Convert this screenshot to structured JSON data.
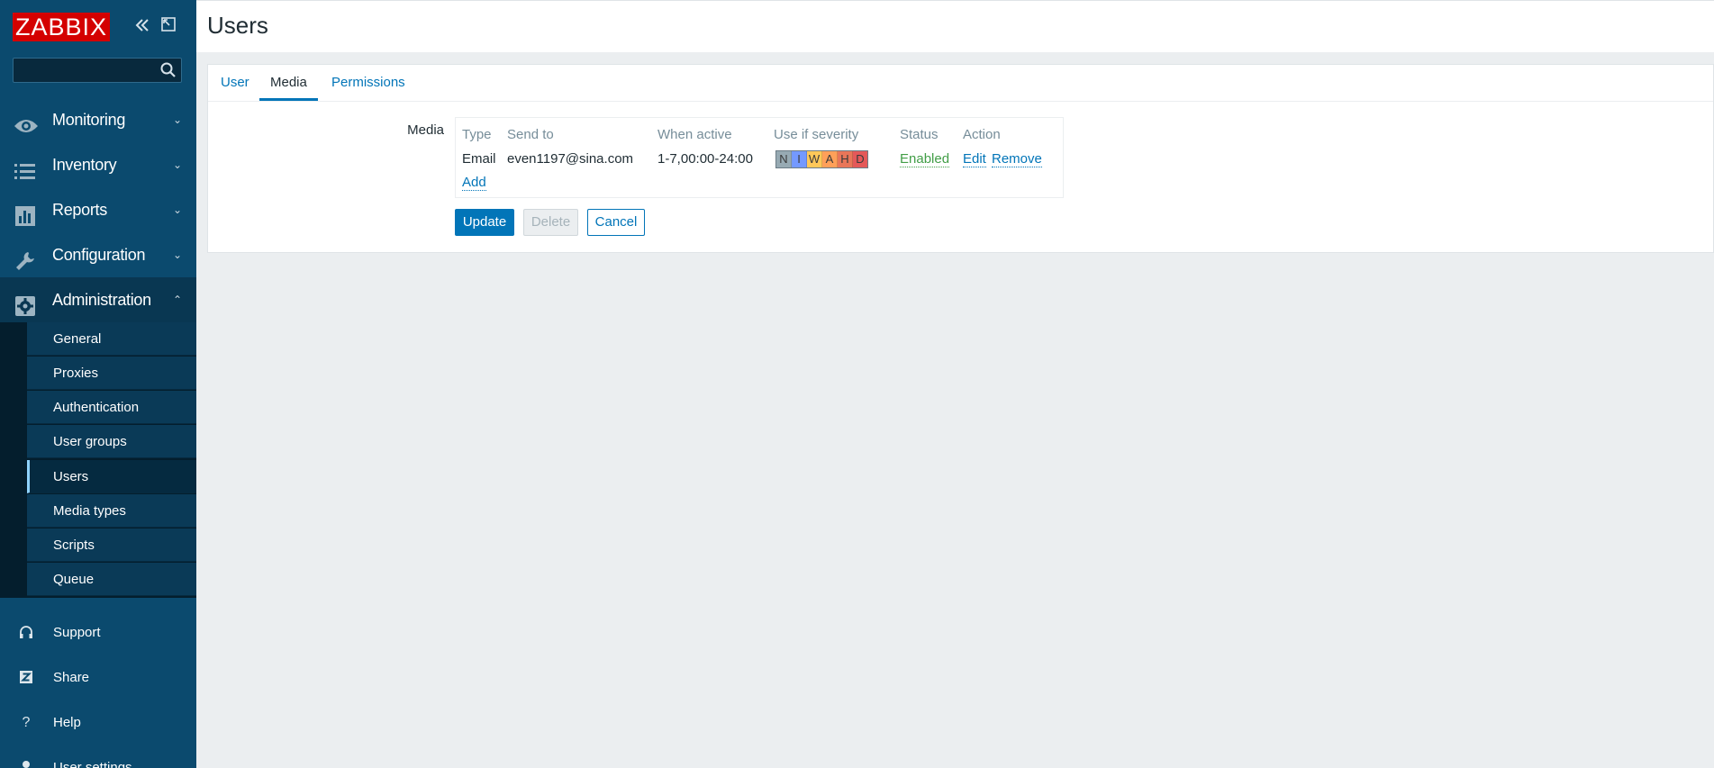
{
  "sidebar": {
    "logo": "ZABBIX",
    "search": {
      "placeholder": ""
    },
    "menu": [
      {
        "label": "Monitoring",
        "icon": "eye-icon"
      },
      {
        "label": "Inventory",
        "icon": "list-icon"
      },
      {
        "label": "Reports",
        "icon": "bar-chart-icon"
      },
      {
        "label": "Configuration",
        "icon": "wrench-icon"
      },
      {
        "label": "Administration",
        "icon": "gear-icon"
      }
    ],
    "submenu": [
      "General",
      "Proxies",
      "Authentication",
      "User groups",
      "Users",
      "Media types",
      "Scripts",
      "Queue"
    ],
    "current_submenu": "Users",
    "bottom": [
      {
        "label": "Support",
        "icon": "headset-icon"
      },
      {
        "label": "Share",
        "icon": "share-z-icon"
      },
      {
        "label": "Help",
        "icon": "question-icon"
      },
      {
        "label": "User settings",
        "icon": "user-icon"
      }
    ]
  },
  "header": {
    "title": "Users"
  },
  "tabs": [
    {
      "label": "User"
    },
    {
      "label": "Media"
    },
    {
      "label": "Permissions"
    }
  ],
  "active_tab": "Media",
  "form": {
    "media_label": "Media",
    "columns": [
      "Type",
      "Send to",
      "When active",
      "Use if severity",
      "Status",
      "Action"
    ],
    "rows": [
      {
        "type": "Email",
        "send_to": "even1197@sina.com",
        "when_active": "1-7,00:00-24:00",
        "severities": [
          {
            "letter": "N",
            "color": "#97aab3"
          },
          {
            "letter": "I",
            "color": "#7499ff"
          },
          {
            "letter": "W",
            "color": "#ffc859"
          },
          {
            "letter": "A",
            "color": "#ffa059"
          },
          {
            "letter": "H",
            "color": "#e97659"
          },
          {
            "letter": "D",
            "color": "#e45959"
          }
        ],
        "status": "Enabled",
        "edit": "Edit",
        "remove": "Remove"
      }
    ],
    "add_link": "Add",
    "buttons": {
      "update": "Update",
      "delete": "Delete",
      "cancel": "Cancel"
    }
  }
}
